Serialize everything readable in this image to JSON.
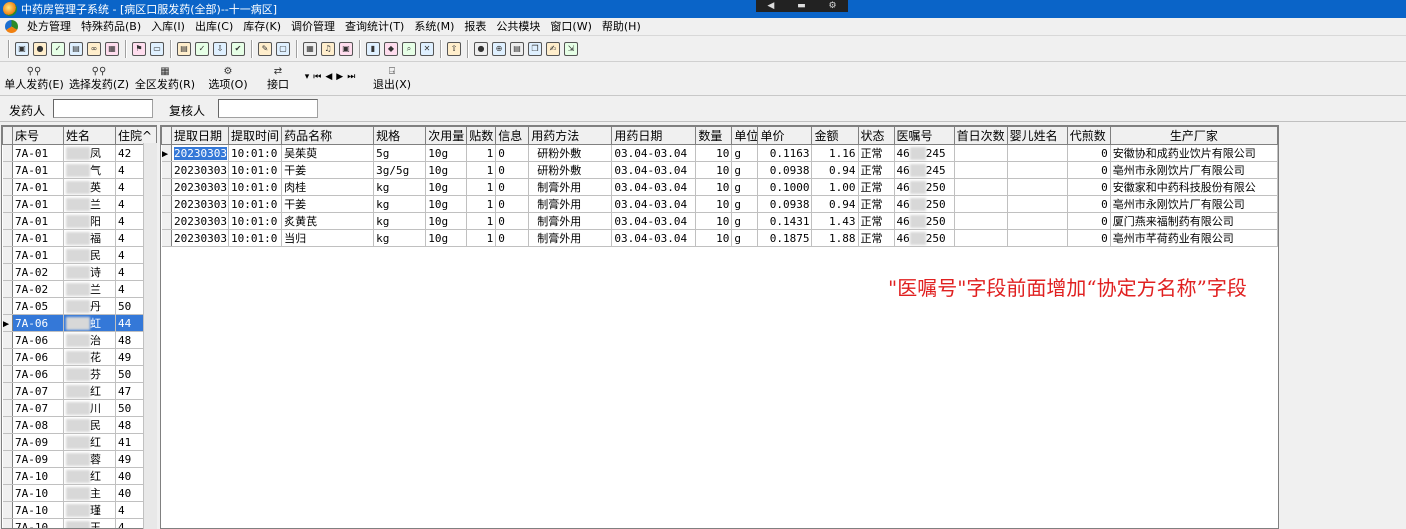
{
  "window": {
    "title": "中药房管理子系统 - [病区口服发药(全部)--十一病区]"
  },
  "floatbar": {
    "btn1": "◀",
    "btn2": "▬",
    "btn3": "⚙"
  },
  "menu": [
    "处方管理",
    "特殊药品(B)",
    "入库(I)",
    "出库(C)",
    "库存(K)",
    "调价管理",
    "查询统计(T)",
    "系统(M)",
    "报表",
    "公共模块",
    "窗口(W)",
    "帮助(H)"
  ],
  "toolbar": {
    "single_dispense": "单人发药(E)",
    "select_dispense": "选择发药(Z)",
    "ward_dispense": "全区发药(R)",
    "options": "选项(O)",
    "interface": "接口",
    "exit": "退出(X)"
  },
  "filter": {
    "dispenser_label": "发药人",
    "reviewer_label": "复核人",
    "dispenser_value": "",
    "reviewer_value": ""
  },
  "patients": {
    "headers": [
      "床号",
      "姓名",
      "住院"
    ],
    "rows": [
      {
        "bed": "7A-01",
        "name": "凤",
        "no": "42"
      },
      {
        "bed": "7A-01",
        "name": "气",
        "no": "4"
      },
      {
        "bed": "7A-01",
        "name": "英",
        "no": "4"
      },
      {
        "bed": "7A-01",
        "name": "兰",
        "no": "4"
      },
      {
        "bed": "7A-01",
        "name": "阳",
        "no": "4"
      },
      {
        "bed": "7A-01",
        "name": "福",
        "no": "4"
      },
      {
        "bed": "7A-01",
        "name": "民",
        "no": "4"
      },
      {
        "bed": "7A-02",
        "name": "诗",
        "no": "4"
      },
      {
        "bed": "7A-02",
        "name": "兰",
        "no": "4"
      },
      {
        "bed": "7A-05",
        "name": "丹",
        "no": "50"
      },
      {
        "bed": "7A-06",
        "name": "虹",
        "no": "44"
      },
      {
        "bed": "7A-06",
        "name": "治",
        "no": "48"
      },
      {
        "bed": "7A-06",
        "name": "花",
        "no": "49"
      },
      {
        "bed": "7A-06",
        "name": "芬",
        "no": "50"
      },
      {
        "bed": "7A-07",
        "name": "红",
        "no": "47"
      },
      {
        "bed": "7A-07",
        "name": "川",
        "no": "50"
      },
      {
        "bed": "7A-08",
        "name": "民",
        "no": "48"
      },
      {
        "bed": "7A-09",
        "name": "红",
        "no": "41"
      },
      {
        "bed": "7A-09",
        "name": "蓉",
        "no": "49"
      },
      {
        "bed": "7A-10",
        "name": "红",
        "no": "40"
      },
      {
        "bed": "7A-10",
        "name": "主",
        "no": "40"
      },
      {
        "bed": "7A-10",
        "name": "瑾",
        "no": "4"
      },
      {
        "bed": "7A-10",
        "name": "玉",
        "no": "4"
      }
    ]
  },
  "orders": {
    "headers": [
      "提取日期",
      "提取时间",
      "药品名称",
      "规格",
      "次用量",
      "贴数",
      "信息",
      "用药方法",
      "用药日期",
      "数量",
      "单位",
      "单价",
      "金额",
      "状态",
      "医嘱号",
      "首日次数",
      "婴儿姓名",
      "代煎数",
      "生产厂家"
    ],
    "rows": [
      {
        "date": "20230303",
        "time": "10:01:0",
        "drug": "吴茱萸",
        "spec": "5g",
        "dose": "10g",
        "packs": "1",
        "info": "0",
        "method": "研粉外敷",
        "usedate": "03.04-03.04",
        "qty": "10",
        "unit": "g",
        "price": "0.1163",
        "amount": "1.16",
        "status": "正常",
        "orderno_a": "46",
        "orderno_b": "245",
        "firstday": "",
        "baby": "",
        "decoct": "0",
        "maker": "安徽协和成药业饮片有限公司"
      },
      {
        "date": "20230303",
        "time": "10:01:0",
        "drug": "干姜",
        "spec": "3g/5g",
        "dose": "10g",
        "packs": "1",
        "info": "0",
        "method": "研粉外敷",
        "usedate": "03.04-03.04",
        "qty": "10",
        "unit": "g",
        "price": "0.0938",
        "amount": "0.94",
        "status": "正常",
        "orderno_a": "46",
        "orderno_b": "245",
        "firstday": "",
        "baby": "",
        "decoct": "0",
        "maker": "亳州市永刚饮片厂有限公司"
      },
      {
        "date": "20230303",
        "time": "10:01:0",
        "drug": "肉桂",
        "spec": "kg",
        "dose": "10g",
        "packs": "1",
        "info": "0",
        "method": "制膏外用",
        "usedate": "03.04-03.04",
        "qty": "10",
        "unit": "g",
        "price": "0.1000",
        "amount": "1.00",
        "status": "正常",
        "orderno_a": "46",
        "orderno_b": "250",
        "firstday": "",
        "baby": "",
        "decoct": "0",
        "maker": "安徽家和中药科技股份有限公"
      },
      {
        "date": "20230303",
        "time": "10:01:0",
        "drug": "干姜",
        "spec": "kg",
        "dose": "10g",
        "packs": "1",
        "info": "0",
        "method": "制膏外用",
        "usedate": "03.04-03.04",
        "qty": "10",
        "unit": "g",
        "price": "0.0938",
        "amount": "0.94",
        "status": "正常",
        "orderno_a": "46",
        "orderno_b": "250",
        "firstday": "",
        "baby": "",
        "decoct": "0",
        "maker": "亳州市永刚饮片厂有限公司"
      },
      {
        "date": "20230303",
        "time": "10:01:0",
        "drug": "炙黄芪",
        "spec": "kg",
        "dose": "10g",
        "packs": "1",
        "info": "0",
        "method": "制膏外用",
        "usedate": "03.04-03.04",
        "qty": "10",
        "unit": "g",
        "price": "0.1431",
        "amount": "1.43",
        "status": "正常",
        "orderno_a": "46",
        "orderno_b": "250",
        "firstday": "",
        "baby": "",
        "decoct": "0",
        "maker": "厦门燕来福制药有限公司"
      },
      {
        "date": "20230303",
        "time": "10:01:0",
        "drug": "当归",
        "spec": "kg",
        "dose": "10g",
        "packs": "1",
        "info": "0",
        "method": "制膏外用",
        "usedate": "03.04-03.04",
        "qty": "10",
        "unit": "g",
        "price": "0.1875",
        "amount": "1.88",
        "status": "正常",
        "orderno_a": "46",
        "orderno_b": "250",
        "firstday": "",
        "baby": "",
        "decoct": "0",
        "maker": "亳州市芊荷药业有限公司"
      }
    ]
  },
  "annotation": "\"医嘱号\"字段前面增加“协定方名称”字段",
  "colors": {
    "titlebar": "#0a64c8",
    "selection": "#3478d8",
    "annotation": "#e02020"
  }
}
